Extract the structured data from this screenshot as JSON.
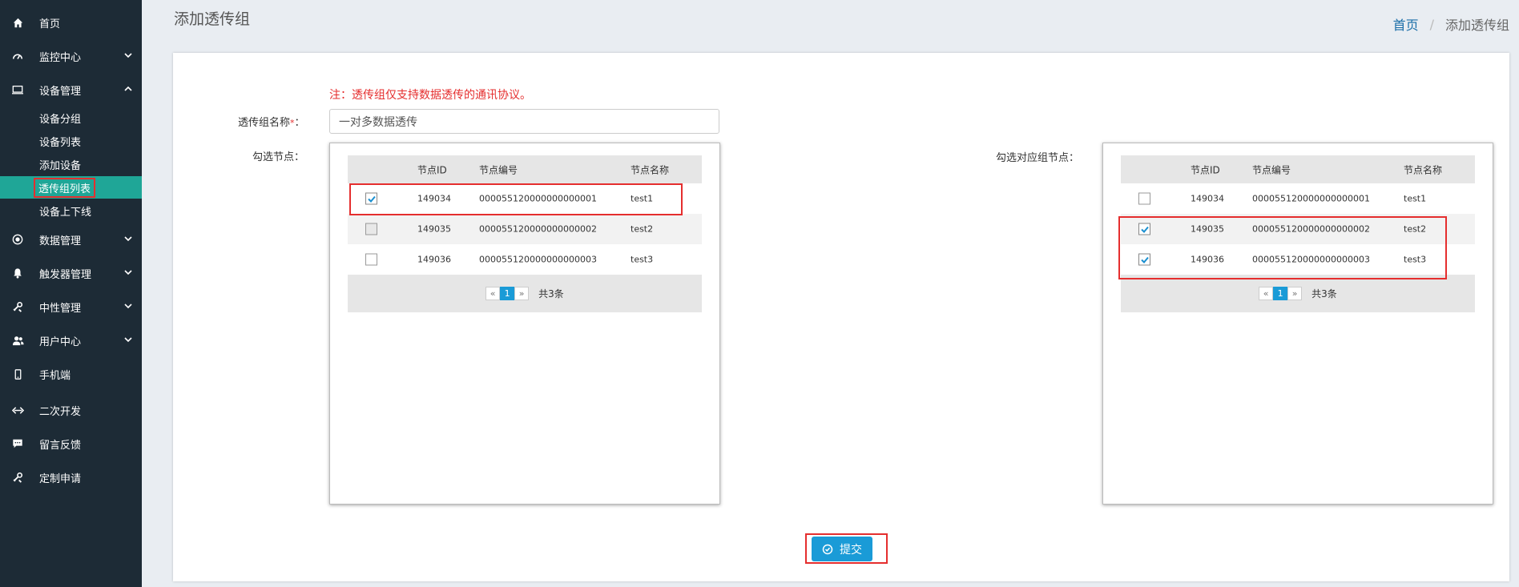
{
  "sidebar": {
    "items": [
      {
        "label": "首页",
        "icon": "home-icon"
      },
      {
        "label": "监控中心",
        "icon": "dashboard-icon"
      },
      {
        "label": "设备管理",
        "icon": "monitor-icon"
      },
      {
        "label": "数据管理",
        "icon": "target-icon"
      },
      {
        "label": "触发器管理",
        "icon": "bell-icon"
      },
      {
        "label": "中性管理",
        "icon": "tools-icon"
      },
      {
        "label": "用户中心",
        "icon": "users-icon"
      },
      {
        "label": "手机端",
        "icon": "mobile-icon"
      },
      {
        "label": "二次开发",
        "icon": "code-icon"
      },
      {
        "label": "留言反馈",
        "icon": "comment-icon"
      },
      {
        "label": "定制申请",
        "icon": "wrench-icon"
      }
    ],
    "sub_items": [
      "设备分组",
      "设备列表",
      "添加设备",
      "透传组列表",
      "设备上下线"
    ]
  },
  "header": {
    "title": "添加透传组",
    "breadcrumb_home": "首页",
    "breadcrumb_sep": "/",
    "breadcrumb_current": "添加透传组"
  },
  "form": {
    "note": "注：透传组仅支持数据透传的通讯协议。",
    "name_label": "透传组名称",
    "required_mark": "*",
    "name_suffix": "：",
    "name_value": "一对多数据透传",
    "select_nodes_label": "勾选节点：",
    "select_target_label": "勾选对应组节点："
  },
  "table": {
    "headers": [
      "节点ID",
      "节点编号",
      "节点名称"
    ],
    "left_rows": [
      {
        "checked": true,
        "id": "149034",
        "code": "000055120000000000001",
        "name": "test1"
      },
      {
        "checked": false,
        "id": "149035",
        "code": "000055120000000000002",
        "name": "test2"
      },
      {
        "checked": false,
        "id": "149036",
        "code": "000055120000000000003",
        "name": "test3"
      }
    ],
    "right_rows": [
      {
        "checked": false,
        "id": "149034",
        "code": "000055120000000000001",
        "name": "test1"
      },
      {
        "checked": true,
        "id": "149035",
        "code": "000055120000000000002",
        "name": "test2"
      },
      {
        "checked": true,
        "id": "149036",
        "code": "000055120000000000003",
        "name": "test3"
      }
    ],
    "pager": {
      "prev": "«",
      "page": "1",
      "next": "»",
      "total": "共3条"
    }
  },
  "submit": {
    "label": "提交"
  },
  "colors": {
    "sidebar": "#1d2b36",
    "active": "#1fa697",
    "primary": "#1a9bd7",
    "highlight": "#e52e2e"
  }
}
